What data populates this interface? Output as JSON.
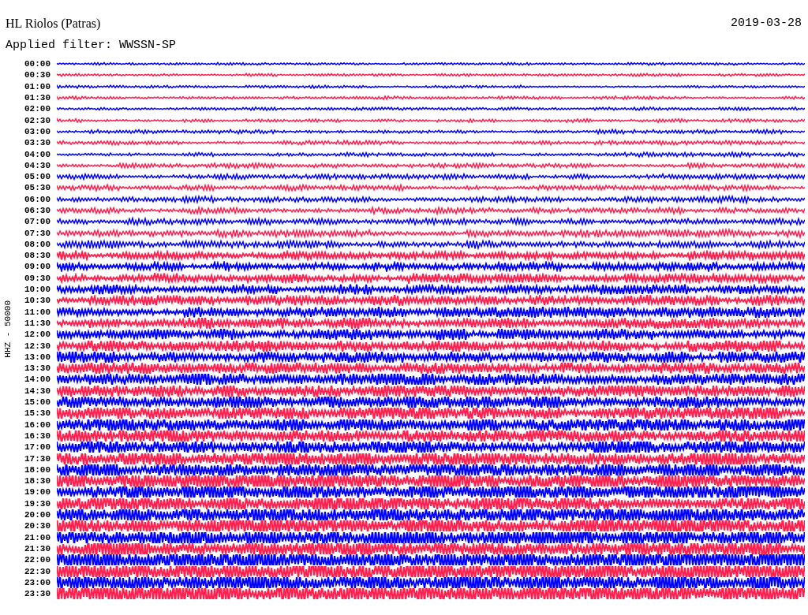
{
  "header": {
    "station": "HL Riolos (Patras)",
    "date": "2019-03-28",
    "filter": "Applied filter: WWSSN-SP"
  },
  "axis_label": "HHZ - 50000",
  "traces": [
    {
      "time": "00:00",
      "color": "#0000ff"
    },
    {
      "time": "00:30",
      "color": "#ff1f4f"
    },
    {
      "time": "01:00",
      "color": "#0000ff"
    },
    {
      "time": "01:30",
      "color": "#ff1f4f"
    },
    {
      "time": "02:00",
      "color": "#0000ff"
    },
    {
      "time": "02:30",
      "color": "#ff1f4f"
    },
    {
      "time": "03:00",
      "color": "#0000ff"
    },
    {
      "time": "03:30",
      "color": "#ff1f4f"
    },
    {
      "time": "04:00",
      "color": "#0000ff"
    },
    {
      "time": "04:30",
      "color": "#ff1f4f"
    },
    {
      "time": "05:00",
      "color": "#0000ff"
    },
    {
      "time": "05:30",
      "color": "#ff1f4f"
    },
    {
      "time": "06:00",
      "color": "#0000ff"
    },
    {
      "time": "06:30",
      "color": "#ff1f4f"
    },
    {
      "time": "07:00",
      "color": "#0000ff"
    },
    {
      "time": "07:30",
      "color": "#ff1f4f"
    },
    {
      "time": "08:00",
      "color": "#0000ff"
    },
    {
      "time": "08:30",
      "color": "#ff1f4f"
    },
    {
      "time": "09:00",
      "color": "#0000ff"
    },
    {
      "time": "09:30",
      "color": "#ff1f4f"
    },
    {
      "time": "10:00",
      "color": "#0000ff"
    },
    {
      "time": "10:30",
      "color": "#ff1f4f"
    },
    {
      "time": "11:00",
      "color": "#0000ff"
    },
    {
      "time": "11:30",
      "color": "#ff1f4f"
    },
    {
      "time": "12:00",
      "color": "#0000ff"
    },
    {
      "time": "12:30",
      "color": "#ff1f4f"
    },
    {
      "time": "13:00",
      "color": "#0000ff"
    },
    {
      "time": "13:30",
      "color": "#ff1f4f"
    },
    {
      "time": "14:00",
      "color": "#0000ff"
    },
    {
      "time": "14:30",
      "color": "#ff1f4f"
    },
    {
      "time": "15:00",
      "color": "#0000ff"
    },
    {
      "time": "15:30",
      "color": "#ff1f4f"
    },
    {
      "time": "16:00",
      "color": "#0000ff"
    },
    {
      "time": "16:30",
      "color": "#ff1f4f"
    },
    {
      "time": "17:00",
      "color": "#0000ff"
    },
    {
      "time": "17:30",
      "color": "#ff1f4f"
    },
    {
      "time": "18:00",
      "color": "#0000ff"
    },
    {
      "time": "18:30",
      "color": "#ff1f4f"
    },
    {
      "time": "19:00",
      "color": "#0000ff"
    },
    {
      "time": "19:30",
      "color": "#ff1f4f"
    },
    {
      "time": "20:00",
      "color": "#0000ff"
    },
    {
      "time": "20:30",
      "color": "#ff1f4f"
    },
    {
      "time": "21:00",
      "color": "#0000ff"
    },
    {
      "time": "21:30",
      "color": "#ff1f4f"
    },
    {
      "time": "22:00",
      "color": "#0000ff"
    },
    {
      "time": "22:30",
      "color": "#ff1f4f"
    },
    {
      "time": "23:00",
      "color": "#0000ff"
    },
    {
      "time": "23:30",
      "color": "#ff1f4f"
    }
  ]
}
